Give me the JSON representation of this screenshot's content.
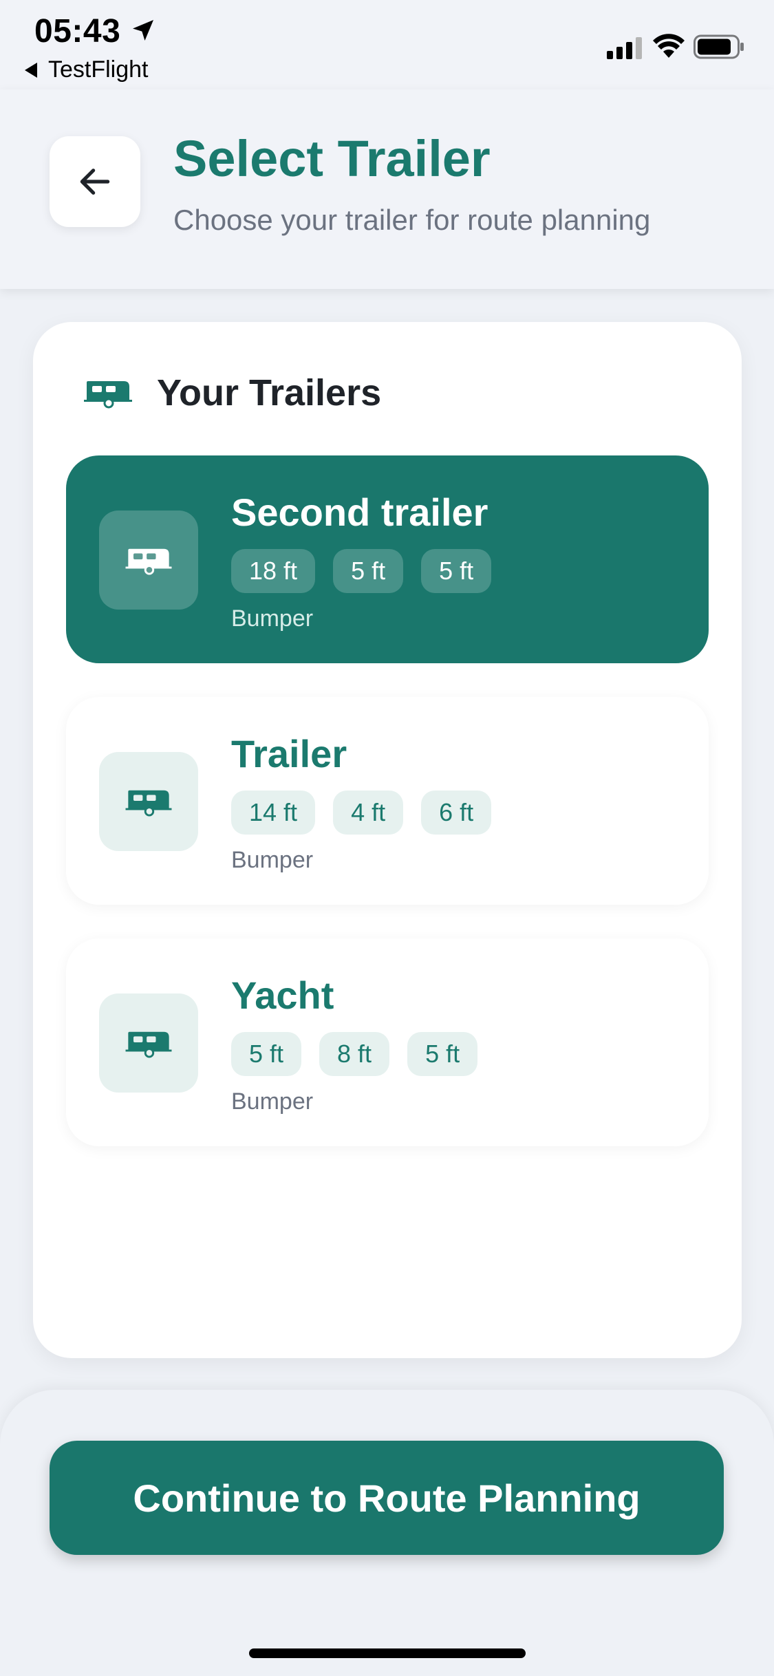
{
  "status_bar": {
    "time": "05:43",
    "back_app": "TestFlight",
    "icons": [
      "location-arrow-icon",
      "cellular-signal-icon",
      "wifi-icon",
      "battery-icon"
    ]
  },
  "header": {
    "title": "Select Trailer",
    "subtitle": "Choose your trailer for route planning",
    "back_icon": "arrow-left-icon"
  },
  "trailers_section": {
    "title": "Your Trailers",
    "icon": "caravan-icon",
    "items": [
      {
        "name": "Second trailer",
        "specs": [
          "18 ft",
          "5 ft",
          "5 ft"
        ],
        "hitch": "Bumper",
        "selected": true
      },
      {
        "name": "Trailer",
        "specs": [
          "14 ft",
          "4 ft",
          "6 ft"
        ],
        "hitch": "Bumper",
        "selected": false
      },
      {
        "name": "Yacht",
        "specs": [
          "5 ft",
          "8 ft",
          "5 ft"
        ],
        "hitch": "Bumper",
        "selected": false
      }
    ]
  },
  "footer": {
    "continue_label": "Continue to Route Planning"
  },
  "colors": {
    "accent": "#1a776c",
    "title": "#1b7a6e",
    "chip_bg": "#e6f1ef",
    "background": "#eef1f6"
  }
}
